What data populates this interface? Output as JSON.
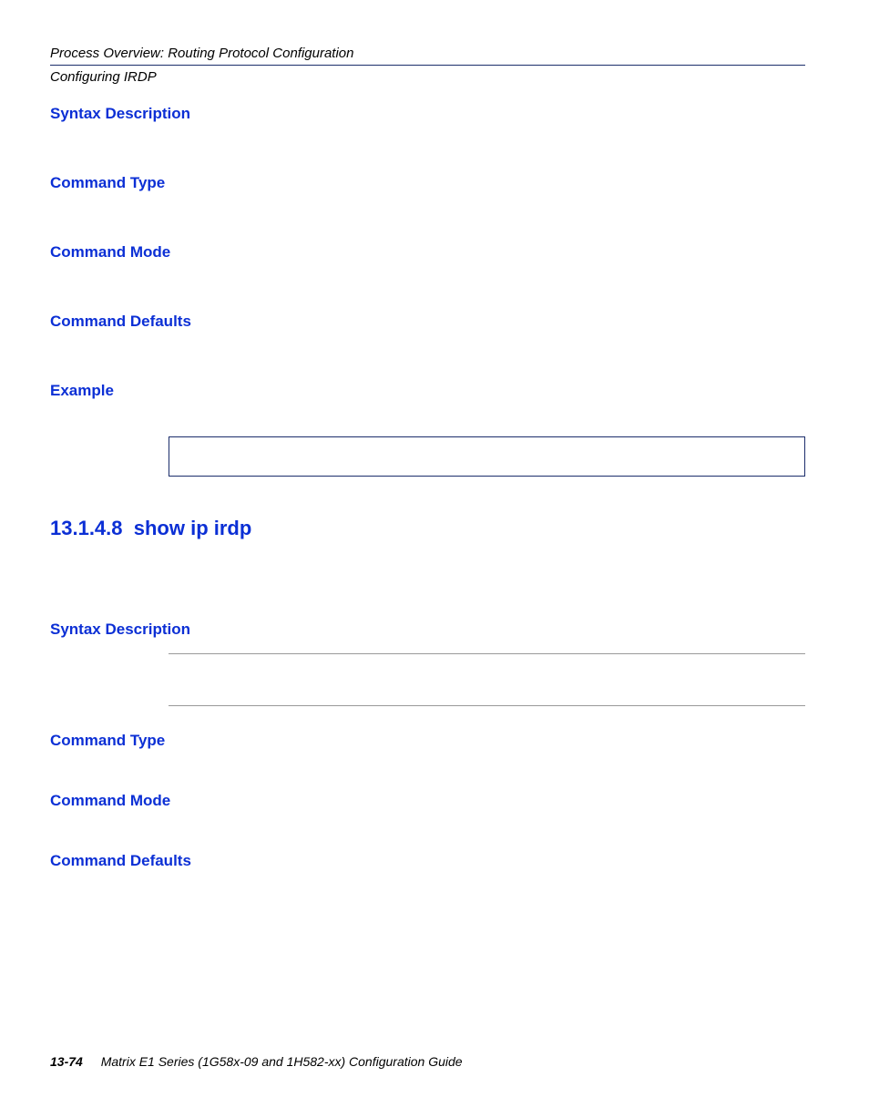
{
  "header": {
    "line1": "Process Overview: Routing Protocol Configuration",
    "line2": "Configuring IRDP"
  },
  "sections1": {
    "syntax_description": {
      "title": "Syntax Description"
    },
    "command_type": {
      "title": "Command Type"
    },
    "command_mode": {
      "title": "Command Mode"
    },
    "command_defaults": {
      "title": "Command Defaults"
    },
    "example": {
      "title": "Example"
    }
  },
  "command_heading": {
    "number": "13.1.4.8",
    "name": "show ip irdp"
  },
  "sections2": {
    "syntax_description": {
      "title": "Syntax Description"
    },
    "command_type": {
      "title": "Command Type"
    },
    "command_mode": {
      "title": "Command Mode"
    },
    "command_defaults": {
      "title": "Command Defaults"
    }
  },
  "footer": {
    "page_number": "13-74",
    "title": "Matrix E1 Series (1G58x-09 and 1H582-xx) Configuration Guide"
  }
}
